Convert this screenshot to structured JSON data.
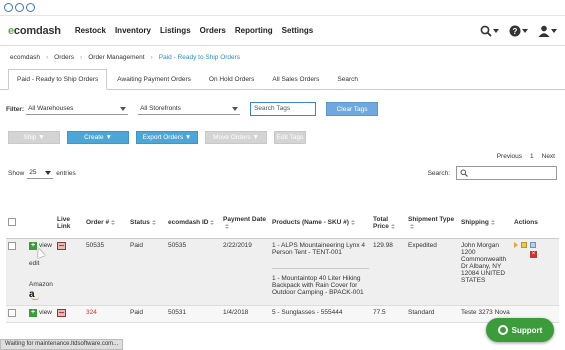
{
  "nav": {
    "logo_prefix": "e",
    "logo_rest": "comdash",
    "items": [
      "Restock",
      "Inventory",
      "Listings",
      "Orders",
      "Reporting",
      "Settings"
    ]
  },
  "breadcrumb": [
    "ecomdash",
    "Orders",
    "Order Management",
    "Paid - Ready to Ship Orders"
  ],
  "tabs": [
    "Paid - Ready to Ship Orders",
    "Awaiting Payment Orders",
    "On Hold Orders",
    "All Sales Orders",
    "Search"
  ],
  "filters": {
    "label": "Filter:",
    "warehouse": "All Warehouses",
    "storefront": "All Storefronts",
    "tags_placeholder": "Search Tags",
    "clear_label": "Clear Tags"
  },
  "actions": {
    "ship": "Ship ▼",
    "create": "Create ▼",
    "export": "Export Orders ▼",
    "move": "Move Orders ▼",
    "edit_tags": "Edit Tags"
  },
  "pager": {
    "previous": "Previous",
    "page": "1",
    "next": "Next"
  },
  "table_controls": {
    "show": "Show",
    "entries_value": "25",
    "entries": "entries",
    "search_label": "Search:"
  },
  "columns": {
    "live_link": "Live Link",
    "order": "Order #",
    "status": "Status",
    "ecomdash_id": "ecomdash ID",
    "payment_date": "Payment Date",
    "products": "Products (Name - SKU #)",
    "total_price": "Total Price",
    "shipment_type": "Shipment Type",
    "shipping": "Shipping",
    "actions": "Actions"
  },
  "rows": [
    {
      "view": "view",
      "edit": "edit",
      "channel": "Amazon",
      "order": "50535",
      "status": "Paid",
      "ecomdash_id": "50535",
      "payment_date": "2/22/2019",
      "product1": "1 - ALPS Mountaineering Lynx 4 Person Tent - TENT-001",
      "product2": "1 - Mountaintop 40 Liter Hiking Backpack with Rain Cover for Outdoor Camping - BPACK-001",
      "total": "129.98",
      "shipment_type": "Expedited",
      "shipping": "John Morgan 1200 Commonwealth Dr Albany, NY 12084 UNITED STATES"
    },
    {
      "view": "view",
      "order": "324",
      "status": "Paid",
      "ecomdash_id": "50531",
      "payment_date": "1/4/2018",
      "product1": "5 - Sunglasses - 555444",
      "total": "77.5",
      "shipment_type": "Standard",
      "shipping": "Teste 3273 Nova"
    }
  ],
  "status_bar": "Waiting for maintenance.ltdsoftware.com...",
  "support": "Support"
}
